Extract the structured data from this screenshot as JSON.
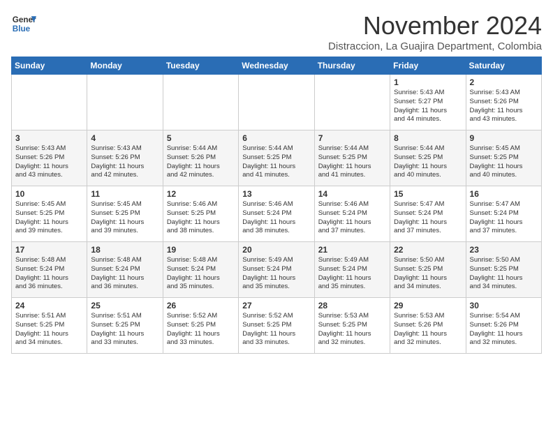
{
  "logo": {
    "line1": "General",
    "line2": "Blue"
  },
  "title": "November 2024",
  "subtitle": "Distraccion, La Guajira Department, Colombia",
  "weekdays": [
    "Sunday",
    "Monday",
    "Tuesday",
    "Wednesday",
    "Thursday",
    "Friday",
    "Saturday"
  ],
  "weeks": [
    [
      {
        "day": "",
        "info": ""
      },
      {
        "day": "",
        "info": ""
      },
      {
        "day": "",
        "info": ""
      },
      {
        "day": "",
        "info": ""
      },
      {
        "day": "",
        "info": ""
      },
      {
        "day": "1",
        "info": "Sunrise: 5:43 AM\nSunset: 5:27 PM\nDaylight: 11 hours\nand 44 minutes."
      },
      {
        "day": "2",
        "info": "Sunrise: 5:43 AM\nSunset: 5:26 PM\nDaylight: 11 hours\nand 43 minutes."
      }
    ],
    [
      {
        "day": "3",
        "info": "Sunrise: 5:43 AM\nSunset: 5:26 PM\nDaylight: 11 hours\nand 43 minutes."
      },
      {
        "day": "4",
        "info": "Sunrise: 5:43 AM\nSunset: 5:26 PM\nDaylight: 11 hours\nand 42 minutes."
      },
      {
        "day": "5",
        "info": "Sunrise: 5:44 AM\nSunset: 5:26 PM\nDaylight: 11 hours\nand 42 minutes."
      },
      {
        "day": "6",
        "info": "Sunrise: 5:44 AM\nSunset: 5:25 PM\nDaylight: 11 hours\nand 41 minutes."
      },
      {
        "day": "7",
        "info": "Sunrise: 5:44 AM\nSunset: 5:25 PM\nDaylight: 11 hours\nand 41 minutes."
      },
      {
        "day": "8",
        "info": "Sunrise: 5:44 AM\nSunset: 5:25 PM\nDaylight: 11 hours\nand 40 minutes."
      },
      {
        "day": "9",
        "info": "Sunrise: 5:45 AM\nSunset: 5:25 PM\nDaylight: 11 hours\nand 40 minutes."
      }
    ],
    [
      {
        "day": "10",
        "info": "Sunrise: 5:45 AM\nSunset: 5:25 PM\nDaylight: 11 hours\nand 39 minutes."
      },
      {
        "day": "11",
        "info": "Sunrise: 5:45 AM\nSunset: 5:25 PM\nDaylight: 11 hours\nand 39 minutes."
      },
      {
        "day": "12",
        "info": "Sunrise: 5:46 AM\nSunset: 5:25 PM\nDaylight: 11 hours\nand 38 minutes."
      },
      {
        "day": "13",
        "info": "Sunrise: 5:46 AM\nSunset: 5:24 PM\nDaylight: 11 hours\nand 38 minutes."
      },
      {
        "day": "14",
        "info": "Sunrise: 5:46 AM\nSunset: 5:24 PM\nDaylight: 11 hours\nand 37 minutes."
      },
      {
        "day": "15",
        "info": "Sunrise: 5:47 AM\nSunset: 5:24 PM\nDaylight: 11 hours\nand 37 minutes."
      },
      {
        "day": "16",
        "info": "Sunrise: 5:47 AM\nSunset: 5:24 PM\nDaylight: 11 hours\nand 37 minutes."
      }
    ],
    [
      {
        "day": "17",
        "info": "Sunrise: 5:48 AM\nSunset: 5:24 PM\nDaylight: 11 hours\nand 36 minutes."
      },
      {
        "day": "18",
        "info": "Sunrise: 5:48 AM\nSunset: 5:24 PM\nDaylight: 11 hours\nand 36 minutes."
      },
      {
        "day": "19",
        "info": "Sunrise: 5:48 AM\nSunset: 5:24 PM\nDaylight: 11 hours\nand 35 minutes."
      },
      {
        "day": "20",
        "info": "Sunrise: 5:49 AM\nSunset: 5:24 PM\nDaylight: 11 hours\nand 35 minutes."
      },
      {
        "day": "21",
        "info": "Sunrise: 5:49 AM\nSunset: 5:24 PM\nDaylight: 11 hours\nand 35 minutes."
      },
      {
        "day": "22",
        "info": "Sunrise: 5:50 AM\nSunset: 5:25 PM\nDaylight: 11 hours\nand 34 minutes."
      },
      {
        "day": "23",
        "info": "Sunrise: 5:50 AM\nSunset: 5:25 PM\nDaylight: 11 hours\nand 34 minutes."
      }
    ],
    [
      {
        "day": "24",
        "info": "Sunrise: 5:51 AM\nSunset: 5:25 PM\nDaylight: 11 hours\nand 34 minutes."
      },
      {
        "day": "25",
        "info": "Sunrise: 5:51 AM\nSunset: 5:25 PM\nDaylight: 11 hours\nand 33 minutes."
      },
      {
        "day": "26",
        "info": "Sunrise: 5:52 AM\nSunset: 5:25 PM\nDaylight: 11 hours\nand 33 minutes."
      },
      {
        "day": "27",
        "info": "Sunrise: 5:52 AM\nSunset: 5:25 PM\nDaylight: 11 hours\nand 33 minutes."
      },
      {
        "day": "28",
        "info": "Sunrise: 5:53 AM\nSunset: 5:25 PM\nDaylight: 11 hours\nand 32 minutes."
      },
      {
        "day": "29",
        "info": "Sunrise: 5:53 AM\nSunset: 5:26 PM\nDaylight: 11 hours\nand 32 minutes."
      },
      {
        "day": "30",
        "info": "Sunrise: 5:54 AM\nSunset: 5:26 PM\nDaylight: 11 hours\nand 32 minutes."
      }
    ]
  ]
}
